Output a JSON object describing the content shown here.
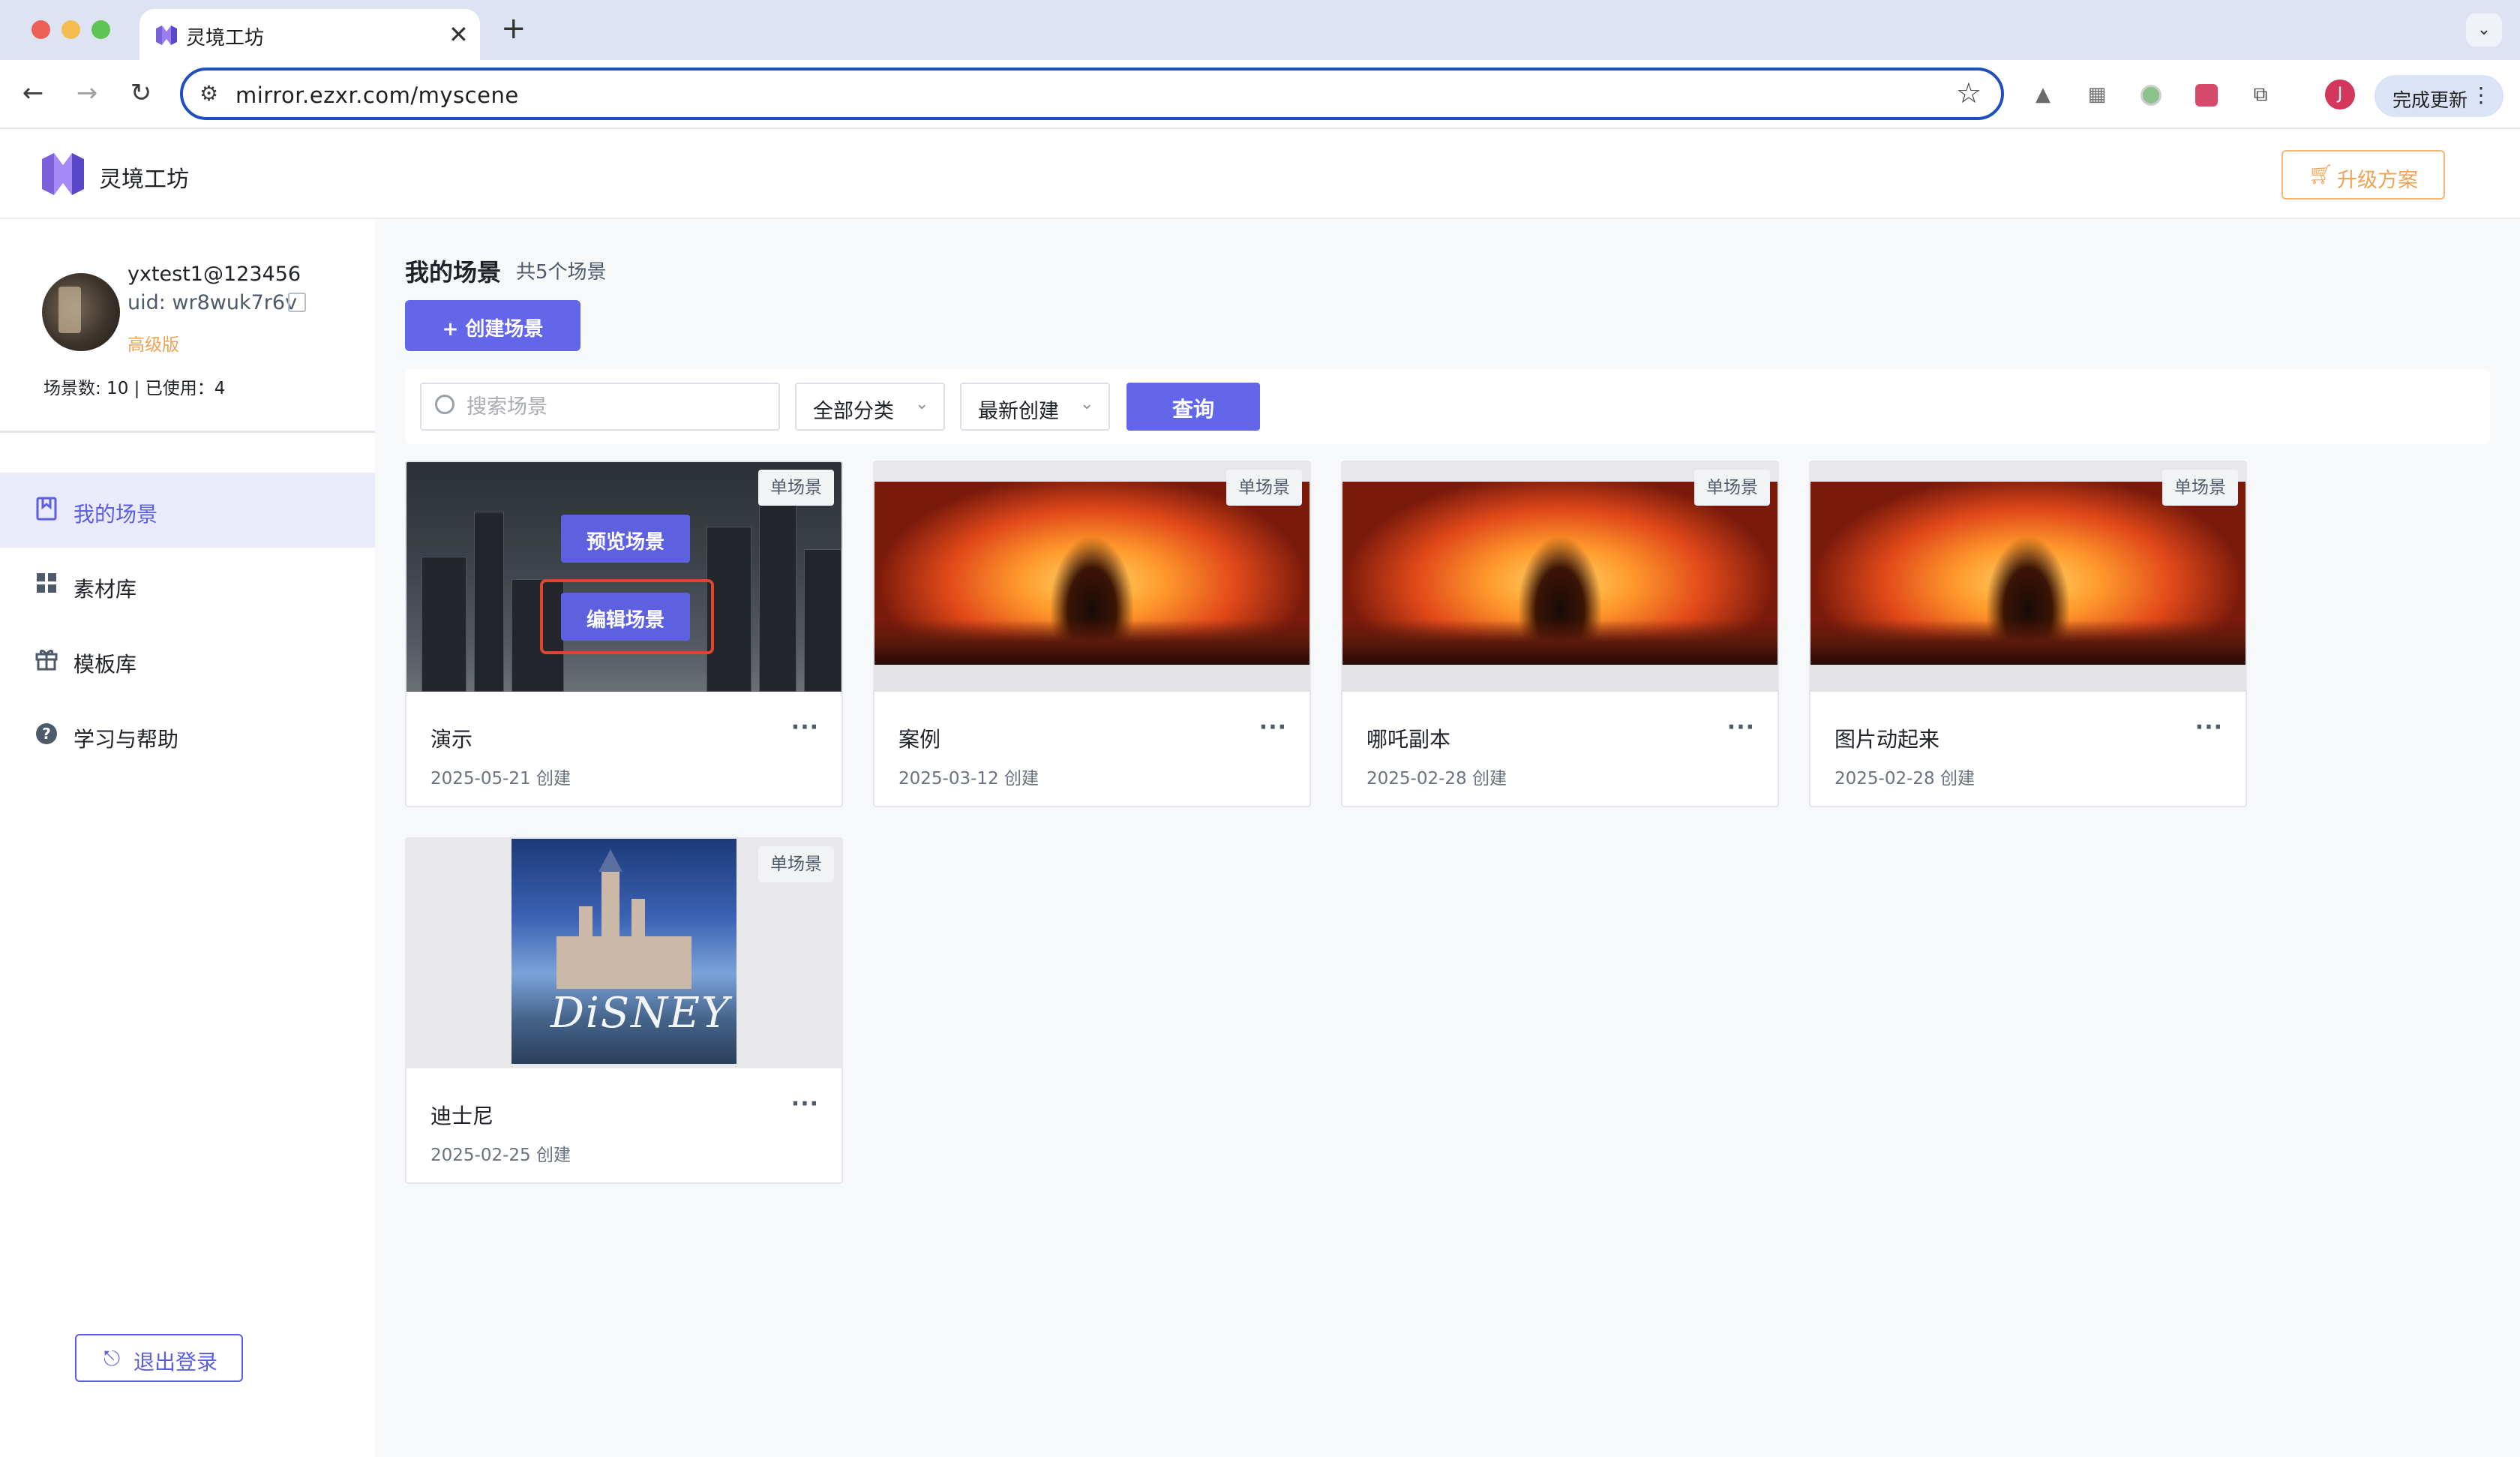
{
  "browser": {
    "tab_title": "灵境工坊",
    "tab_close": "✕",
    "new_tab": "+",
    "tab_menu": "⌄",
    "url": "mirror.ezxr.com/myscene",
    "profile_initial": "J",
    "update_label": "完成更新",
    "update_menu": "⋮"
  },
  "app": {
    "brand": "灵境工坊",
    "upgrade_label": "升级方案",
    "accent_color": "#6366e8",
    "warning_color": "#f0a356"
  },
  "user": {
    "username": "yxtest1@123456",
    "uid": "uid: wr8wuk7r6v",
    "tier": "高级版",
    "quota": "场景数: 10 | 已使用：4"
  },
  "sidebar": {
    "items": [
      {
        "label": "我的场景",
        "icon": "bookmark-icon",
        "active": true
      },
      {
        "label": "素材库",
        "icon": "grid-icon",
        "active": false
      },
      {
        "label": "模板库",
        "icon": "gift-icon",
        "active": false
      },
      {
        "label": "学习与帮助",
        "icon": "help-icon",
        "active": false
      }
    ],
    "logout_label": "退出登录"
  },
  "main": {
    "title": "我的场景",
    "count": "共5个场景",
    "create_label": "+ 创建场景",
    "search_placeholder": "搜索场景",
    "category_select": "全部分类",
    "sort_select": "最新创建",
    "query_label": "查询"
  },
  "scenes": [
    {
      "title": "演示",
      "date": "2025-05-21 创建",
      "badge": "单场景",
      "more": "···",
      "preview_label": "预览场景",
      "edit_label": "编辑场景"
    },
    {
      "title": "案例",
      "date": "2025-03-12 创建",
      "badge": "单场景",
      "more": "···"
    },
    {
      "title": "哪吒副本",
      "date": "2025-02-28 创建",
      "badge": "单场景",
      "more": "···"
    },
    {
      "title": "图片动起来",
      "date": "2025-02-28 创建",
      "badge": "单场景",
      "more": "···"
    },
    {
      "title": "迪士尼",
      "date": "2025-02-25 创建",
      "badge": "单场景",
      "more": "···",
      "image_text": "DiSNEY"
    }
  ]
}
